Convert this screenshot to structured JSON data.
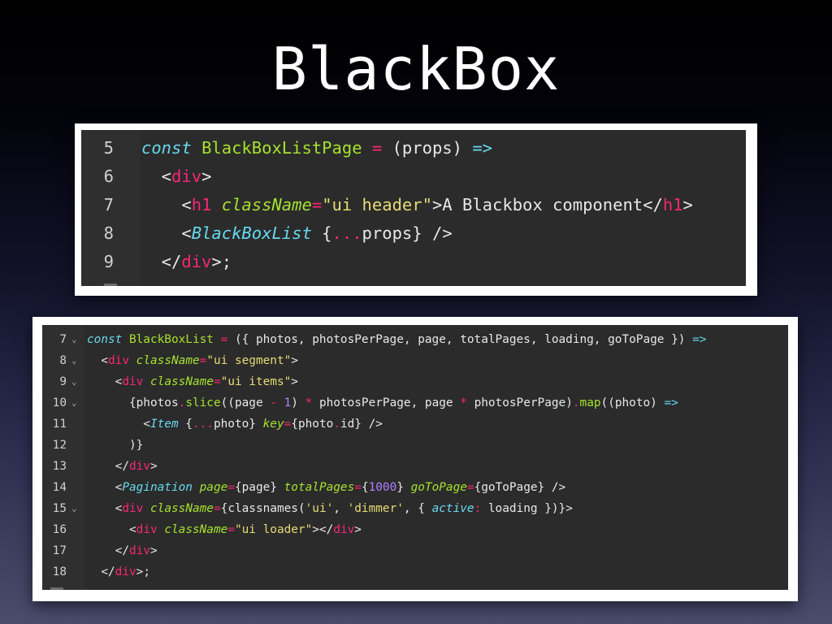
{
  "slide": {
    "title": "BlackBox"
  },
  "panel1": {
    "lines": [
      {
        "number": "5",
        "tokens": [
          {
            "t": "const ",
            "c": "kw"
          },
          {
            "t": "BlackBoxListPage",
            "c": "fn"
          },
          {
            "t": " = ",
            "c": "op"
          },
          {
            "t": "(props) ",
            "c": "pl"
          },
          {
            "t": "=>",
            "c": "ar"
          }
        ]
      },
      {
        "number": "6",
        "tokens": [
          {
            "t": "  <",
            "c": "pl"
          },
          {
            "t": "div",
            "c": "tag"
          },
          {
            "t": ">",
            "c": "pl"
          }
        ]
      },
      {
        "number": "7",
        "tokens": [
          {
            "t": "    <",
            "c": "pl"
          },
          {
            "t": "h1",
            "c": "tag"
          },
          {
            "t": " ",
            "c": "pl"
          },
          {
            "t": "className",
            "c": "attr"
          },
          {
            "t": "=",
            "c": "op"
          },
          {
            "t": "\"ui header\"",
            "c": "str"
          },
          {
            "t": ">A Blackbox component</",
            "c": "pl"
          },
          {
            "t": "h1",
            "c": "tag"
          },
          {
            "t": ">",
            "c": "pl"
          }
        ]
      },
      {
        "number": "8",
        "tokens": [
          {
            "t": "    <",
            "c": "pl"
          },
          {
            "t": "BlackBoxList",
            "c": "comp"
          },
          {
            "t": " {",
            "c": "pl"
          },
          {
            "t": "...",
            "c": "op"
          },
          {
            "t": "props} />",
            "c": "pl"
          }
        ]
      },
      {
        "number": "9",
        "tokens": [
          {
            "t": "  </",
            "c": "pl"
          },
          {
            "t": "div",
            "c": "tag"
          },
          {
            "t": ">;",
            "c": "pl"
          }
        ]
      }
    ]
  },
  "panel2": {
    "lines": [
      {
        "number": "7",
        "fold": true,
        "tokens": [
          {
            "t": "const ",
            "c": "kw"
          },
          {
            "t": "BlackBoxList",
            "c": "fn"
          },
          {
            "t": " = ",
            "c": "op"
          },
          {
            "t": "({ photos, photosPerPage, page, totalPages, loading, goToPage }) ",
            "c": "pl"
          },
          {
            "t": "=>",
            "c": "ar"
          }
        ]
      },
      {
        "number": "8",
        "fold": true,
        "tokens": [
          {
            "t": "  <",
            "c": "pl"
          },
          {
            "t": "div",
            "c": "tag"
          },
          {
            "t": " ",
            "c": "pl"
          },
          {
            "t": "className",
            "c": "attr"
          },
          {
            "t": "=",
            "c": "op"
          },
          {
            "t": "\"ui segment\"",
            "c": "str"
          },
          {
            "t": ">",
            "c": "pl"
          }
        ]
      },
      {
        "number": "9",
        "fold": true,
        "tokens": [
          {
            "t": "    <",
            "c": "pl"
          },
          {
            "t": "div",
            "c": "tag"
          },
          {
            "t": " ",
            "c": "pl"
          },
          {
            "t": "className",
            "c": "attr"
          },
          {
            "t": "=",
            "c": "op"
          },
          {
            "t": "\"ui items\"",
            "c": "str"
          },
          {
            "t": ">",
            "c": "pl"
          }
        ]
      },
      {
        "number": "10",
        "fold": true,
        "tokens": [
          {
            "t": "      {photos",
            "c": "pl"
          },
          {
            "t": ".",
            "c": "op"
          },
          {
            "t": "slice",
            "c": "fn"
          },
          {
            "t": "((page ",
            "c": "pl"
          },
          {
            "t": "- ",
            "c": "op"
          },
          {
            "t": "1",
            "c": "num"
          },
          {
            "t": ") ",
            "c": "pl"
          },
          {
            "t": "* ",
            "c": "op"
          },
          {
            "t": "photosPerPage, page ",
            "c": "pl"
          },
          {
            "t": "* ",
            "c": "op"
          },
          {
            "t": "photosPerPage)",
            "c": "pl"
          },
          {
            "t": ".",
            "c": "op"
          },
          {
            "t": "map",
            "c": "fn"
          },
          {
            "t": "((photo) ",
            "c": "pl"
          },
          {
            "t": "=>",
            "c": "ar"
          }
        ]
      },
      {
        "number": "11",
        "fold": false,
        "tokens": [
          {
            "t": "        <",
            "c": "pl"
          },
          {
            "t": "Item",
            "c": "comp"
          },
          {
            "t": " {",
            "c": "pl"
          },
          {
            "t": "...",
            "c": "op"
          },
          {
            "t": "photo} ",
            "c": "pl"
          },
          {
            "t": "key",
            "c": "attr"
          },
          {
            "t": "=",
            "c": "op"
          },
          {
            "t": "{photo",
            "c": "pl"
          },
          {
            "t": ".",
            "c": "op"
          },
          {
            "t": "id} />",
            "c": "pl"
          }
        ]
      },
      {
        "number": "12",
        "fold": false,
        "tokens": [
          {
            "t": "      )}",
            "c": "pl"
          }
        ]
      },
      {
        "number": "13",
        "fold": false,
        "tokens": [
          {
            "t": "    </",
            "c": "pl"
          },
          {
            "t": "div",
            "c": "tag"
          },
          {
            "t": ">",
            "c": "pl"
          }
        ]
      },
      {
        "number": "14",
        "fold": false,
        "tokens": [
          {
            "t": "    <",
            "c": "pl"
          },
          {
            "t": "Pagination",
            "c": "comp"
          },
          {
            "t": " ",
            "c": "pl"
          },
          {
            "t": "page",
            "c": "attr"
          },
          {
            "t": "=",
            "c": "op"
          },
          {
            "t": "{page} ",
            "c": "pl"
          },
          {
            "t": "totalPages",
            "c": "attr"
          },
          {
            "t": "=",
            "c": "op"
          },
          {
            "t": "{",
            "c": "pl"
          },
          {
            "t": "1000",
            "c": "num"
          },
          {
            "t": "} ",
            "c": "pl"
          },
          {
            "t": "goToPage",
            "c": "attr"
          },
          {
            "t": "=",
            "c": "op"
          },
          {
            "t": "{goToPage} />",
            "c": "pl"
          }
        ]
      },
      {
        "number": "15",
        "fold": true,
        "tokens": [
          {
            "t": "    <",
            "c": "pl"
          },
          {
            "t": "div",
            "c": "tag"
          },
          {
            "t": " ",
            "c": "pl"
          },
          {
            "t": "className",
            "c": "attr"
          },
          {
            "t": "=",
            "c": "op"
          },
          {
            "t": "{classnames(",
            "c": "pl"
          },
          {
            "t": "'ui'",
            "c": "str"
          },
          {
            "t": ", ",
            "c": "pl"
          },
          {
            "t": "'dimmer'",
            "c": "str"
          },
          {
            "t": ", { ",
            "c": "pl"
          },
          {
            "t": "active",
            "c": "kw"
          },
          {
            "t": ": ",
            "c": "op"
          },
          {
            "t": "loading })}>",
            "c": "pl"
          }
        ]
      },
      {
        "number": "16",
        "fold": false,
        "tokens": [
          {
            "t": "      <",
            "c": "pl"
          },
          {
            "t": "div",
            "c": "tag"
          },
          {
            "t": " ",
            "c": "pl"
          },
          {
            "t": "className",
            "c": "attr"
          },
          {
            "t": "=",
            "c": "op"
          },
          {
            "t": "\"ui loader\"",
            "c": "str"
          },
          {
            "t": "></",
            "c": "pl"
          },
          {
            "t": "div",
            "c": "tag"
          },
          {
            "t": ">",
            "c": "pl"
          }
        ]
      },
      {
        "number": "17",
        "fold": false,
        "tokens": [
          {
            "t": "    </",
            "c": "pl"
          },
          {
            "t": "div",
            "c": "tag"
          },
          {
            "t": ">",
            "c": "pl"
          }
        ]
      },
      {
        "number": "18",
        "fold": false,
        "tokens": [
          {
            "t": "  </",
            "c": "pl"
          },
          {
            "t": "div",
            "c": "tag"
          },
          {
            "t": ">;",
            "c": "pl"
          }
        ]
      }
    ]
  },
  "icons": {
    "fold": "chevron-down-icon"
  },
  "colors": {
    "editor_bg": "#2b2b2b",
    "keyword": "#66d9ef",
    "tag": "#f92672",
    "attribute": "#a6e22e",
    "string": "#e6db74",
    "number": "#ae81ff",
    "text": "#e8e8e8"
  }
}
